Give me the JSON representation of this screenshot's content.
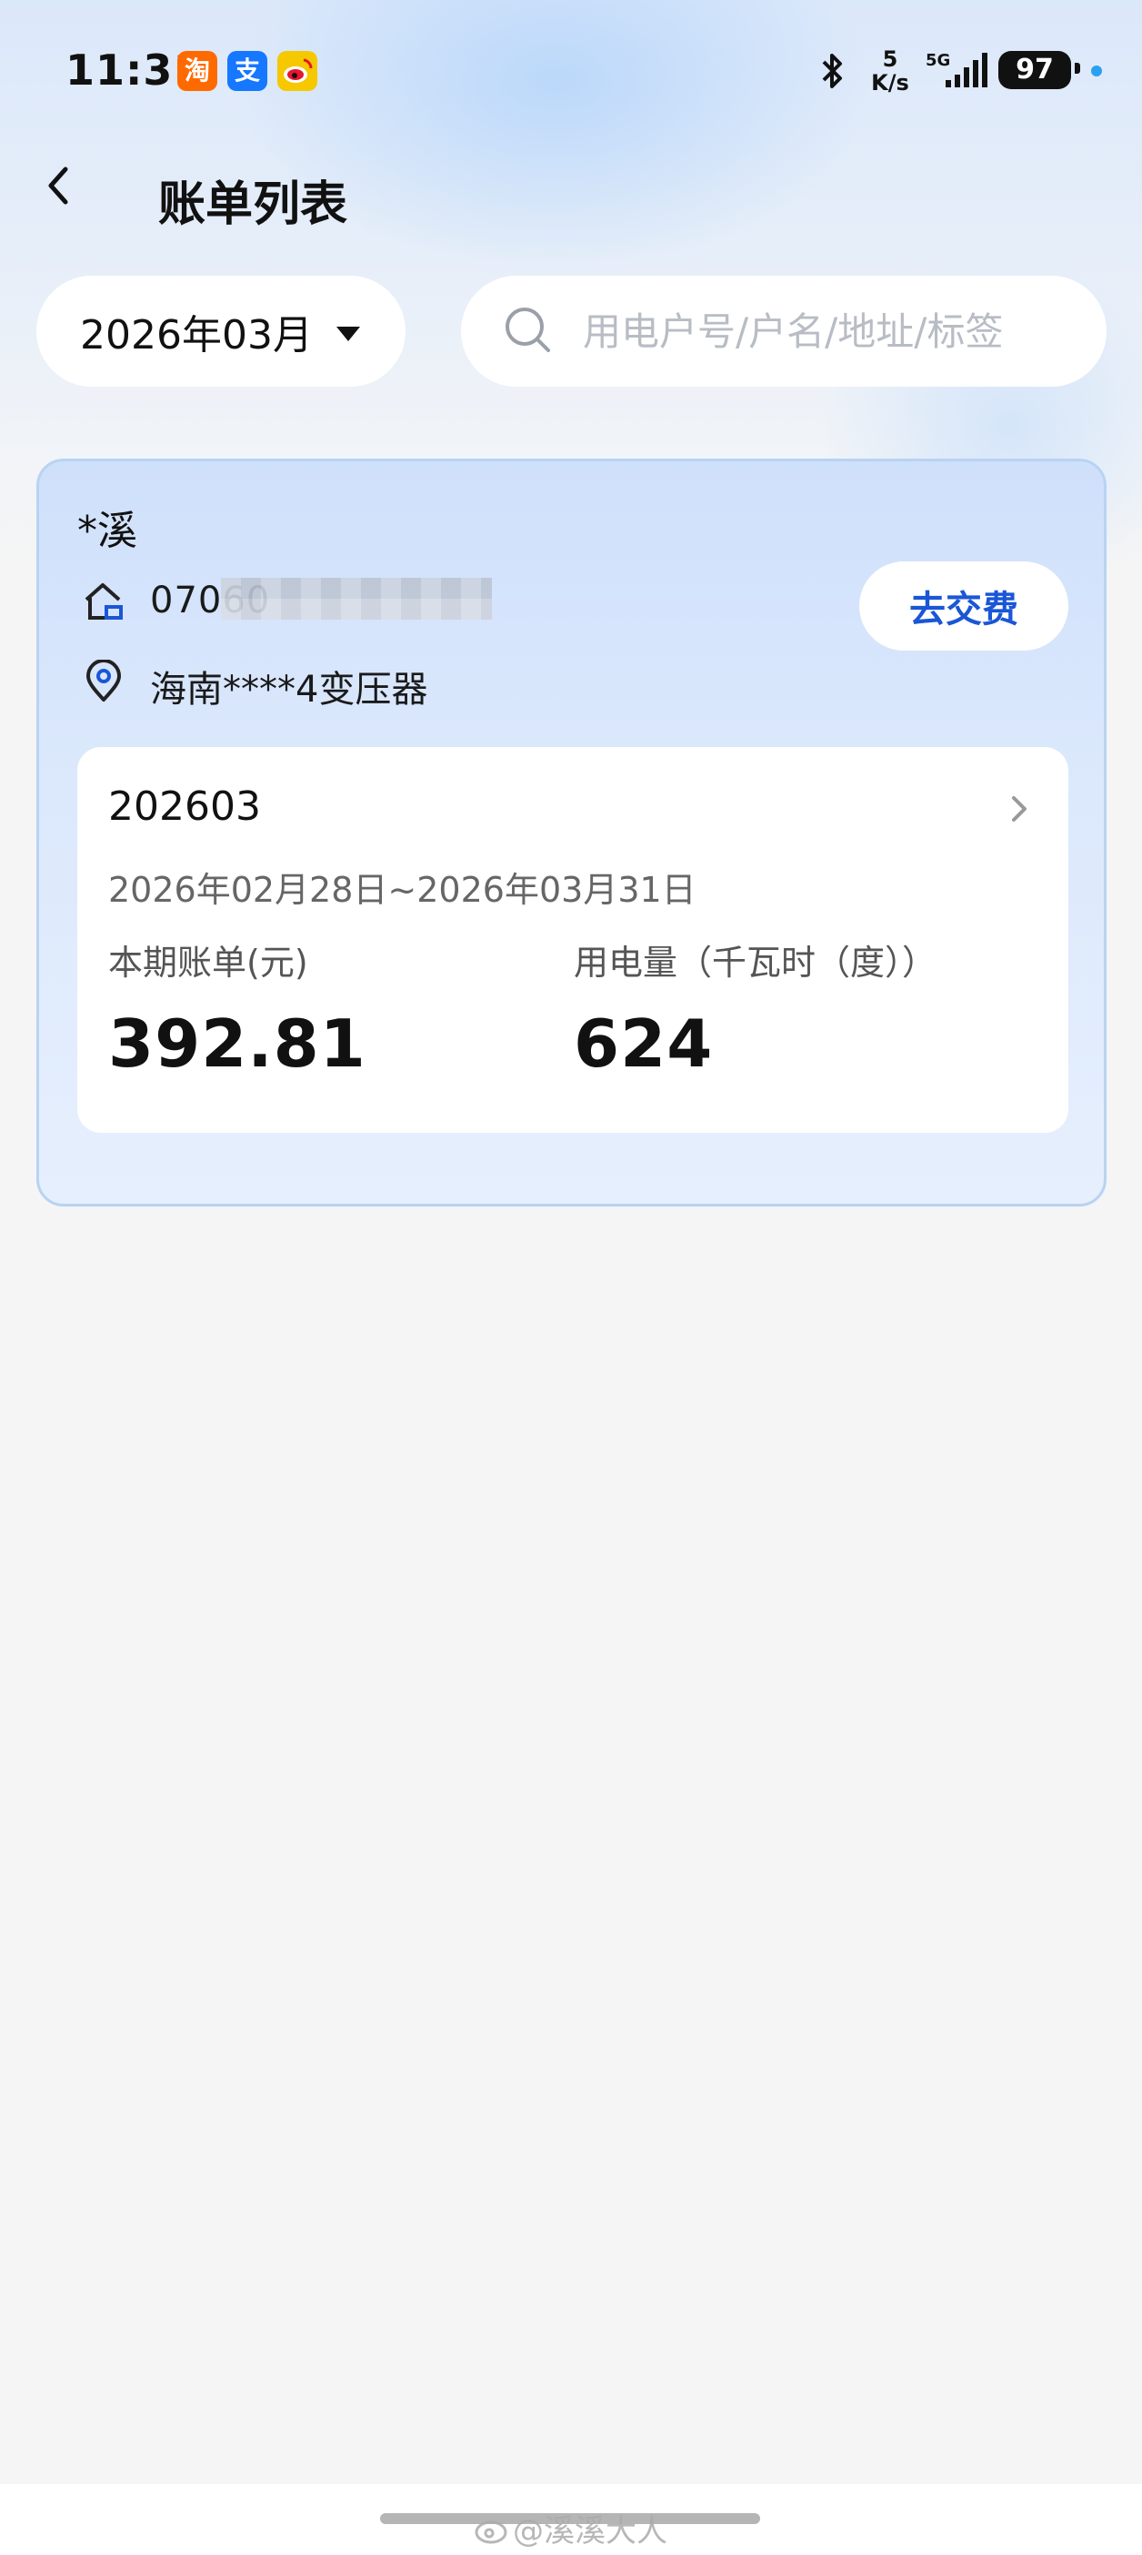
{
  "status_bar": {
    "time": "11:31",
    "apps": [
      {
        "name": "taobao",
        "glyph": "淘",
        "color": "#ff6a00"
      },
      {
        "name": "alipay",
        "glyph": "支",
        "color": "#1677ff"
      },
      {
        "name": "weibo",
        "glyph": "",
        "color": "#f5c800"
      }
    ],
    "net_speed_value": "5",
    "net_speed_unit": "K/s",
    "network": "5G",
    "battery": "97"
  },
  "header": {
    "title": "账单列表"
  },
  "filters": {
    "month": "2026年03月",
    "search_placeholder": "用电户号/户名/地址/标签"
  },
  "account": {
    "name": "*溪",
    "number_visible": "07060",
    "address": "海南****4变压器",
    "pay_label": "去交费"
  },
  "bill": {
    "period": "202603",
    "date_range": "2026年02月28日~2026年03月31日",
    "amount_label": "本期账单(元)",
    "amount": "392.81",
    "usage_label": "用电量（千瓦时（度））",
    "usage": "624"
  },
  "watermark": "@溪溪大人",
  "colors": {
    "accent": "#1a56d6",
    "card_border": "#b8d3f3",
    "background": "#f5f5f5"
  }
}
